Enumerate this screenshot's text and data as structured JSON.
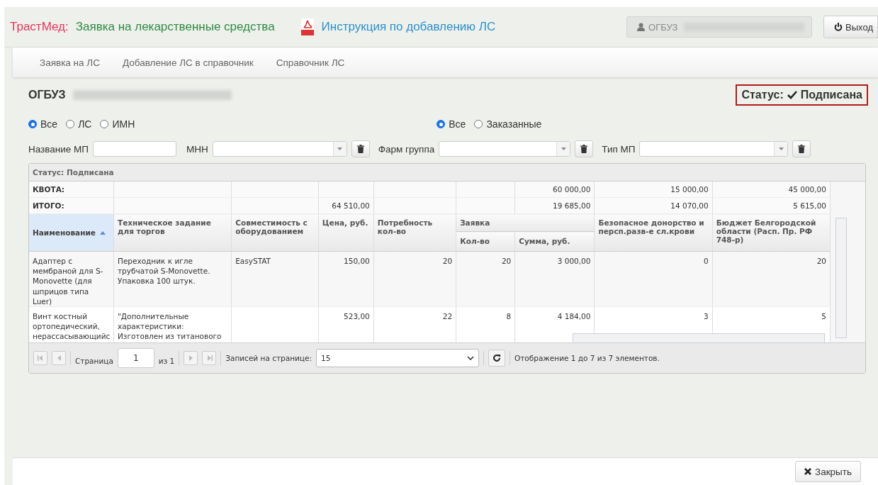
{
  "header": {
    "brand": "ТрастМед:",
    "title": "Заявка на лекарственные средства",
    "instruction_link": "Инструкция по добавлению ЛС",
    "user_prefix": "ОГБУЗ",
    "logout": "Выход"
  },
  "nav": [
    {
      "label": "Заявка на ЛС"
    },
    {
      "label": "Добавление ЛС в справочник"
    },
    {
      "label": "Справочник ЛС"
    }
  ],
  "org": {
    "prefix": "ОГБУЗ"
  },
  "status_badge": {
    "label": "Статус:",
    "value": "Подписана"
  },
  "type_filter": [
    {
      "label": "Все",
      "selected": true
    },
    {
      "label": "ЛС",
      "selected": false
    },
    {
      "label": "ИМН",
      "selected": false
    }
  ],
  "order_filter": [
    {
      "label": "Все",
      "selected": true
    },
    {
      "label": "Заказанные",
      "selected": false
    }
  ],
  "fields": [
    {
      "kind": "text",
      "label": "Название МП"
    },
    {
      "kind": "combo",
      "label": "МНН"
    },
    {
      "kind": "combo",
      "label": "Фарм группа"
    },
    {
      "kind": "combo",
      "label": "Тип МП"
    }
  ],
  "grid": {
    "title": "Статус: Подписана",
    "summary_rows": [
      {
        "label": "КВОТА:",
        "cells": [
          null,
          null,
          null,
          null,
          null,
          "60 000,00",
          "15 000,00",
          "45 000,00"
        ]
      },
      {
        "label": "ИТОГО:",
        "cells": [
          null,
          null,
          "64 510,00",
          null,
          null,
          "19 685,00",
          "14 070,00",
          "5 615,00"
        ]
      }
    ],
    "columns": [
      {
        "label": "Наименование",
        "sorted": true
      },
      {
        "label": "Техническое задание для торгов",
        "sorted": false
      },
      {
        "label": "Совместимость с оборудованием",
        "sorted": false
      },
      {
        "label": "Цена, руб.",
        "sorted": false
      },
      {
        "label": "Потребность кол-во",
        "sorted": false
      },
      {
        "label": "Кол-во",
        "sorted": false,
        "group": {
          "label": "Заявка"
        }
      },
      {
        "label": "Сумма, руб.",
        "sorted": false,
        "group_continues": true
      },
      {
        "label": "Безопасное донорство и персп.разв-е сл.крови",
        "sorted": false
      },
      {
        "label": "Бюджет Белгородской области (Расп. Пр. РФ 748-р)",
        "sorted": false
      }
    ],
    "rows": [
      {
        "cells": [
          "Адаптер с мембраной для S-Monovette (для шприцов типа Luer)",
          "Переходник к игле трубчатой S-Monovette. Упаковка 100 штук.",
          "EasySTAT",
          "150,00",
          "20",
          "20",
          "3 000,00",
          "0",
          "20"
        ]
      },
      {
        "cells": [
          "Винт костный ортопедический, нерассасывающийс",
          "\"Дополнительные характеристики: Изготовлен из титанового",
          "",
          "523,00",
          "22",
          "8",
          "4 184,00",
          "3",
          "5"
        ]
      }
    ]
  },
  "pager": {
    "page_label": "Страница",
    "page": "1",
    "of": "из 1",
    "per_page_label": "Записей на странице:",
    "per_page": "15",
    "summary": "Отображение 1 до 7 из 7 элементов."
  },
  "footer": {
    "close": "Закрыть"
  }
}
